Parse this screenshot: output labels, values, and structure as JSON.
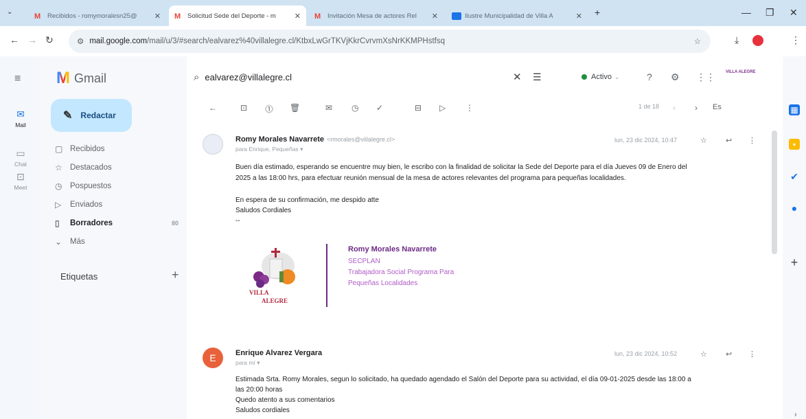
{
  "browser": {
    "tabs": [
      {
        "label": "Recibidos - romymoralesn25@",
        "active": false
      },
      {
        "label": "Solicitud Sede del Deporte - m",
        "active": true
      },
      {
        "label": "Invitación Mesa de actores Rel",
        "active": false
      },
      {
        "label": "Ilustre Municipalidad de Villa A",
        "active": false
      }
    ],
    "new_tab": "+",
    "url_host": "mail.google.com",
    "url_path": "/mail/u/3/#search/ealvarez%40villalegre.cl/KtbxLwGrTKVjKkrCvrvmXsNrKKMPHstfsq"
  },
  "rail": {
    "items": [
      {
        "label": "Mail",
        "icon": "mail-icon"
      },
      {
        "label": "Chat",
        "icon": "chat-icon"
      },
      {
        "label": "Meet",
        "icon": "video-icon"
      }
    ]
  },
  "gmail": {
    "logo_text": "Gmail",
    "search_value": "ealvarez@villalegre.cl",
    "status_label": "Activo",
    "brand_text": "VILLA ALEGRE"
  },
  "sidebar": {
    "compose": "Redactar",
    "items": [
      {
        "label": "Recibidos",
        "icon": "inbox-icon",
        "count": ""
      },
      {
        "label": "Destacados",
        "icon": "star-icon",
        "count": ""
      },
      {
        "label": "Pospuestos",
        "icon": "clock-icon",
        "count": ""
      },
      {
        "label": "Enviados",
        "icon": "send-icon",
        "count": ""
      },
      {
        "label": "Borradores",
        "icon": "draft-icon",
        "count": "80"
      },
      {
        "label": "Más",
        "icon": "chevron-down-icon",
        "count": ""
      }
    ],
    "labels_heading": "Etiquetas"
  },
  "toolbar": {
    "pager": "1 de 18",
    "lang": "Es"
  },
  "messages": [
    {
      "sender": "Romy Morales Navarrete",
      "email": "<rmorales@villalegre.cl>",
      "to": "para Enrique, Pequeñas",
      "date": "lun, 23 dic 2024, 10:47",
      "lines": [
        "Buen día estimado, esperando se encuentre muy bien, le escribo con la finalidad de solicitar la Sede del Deporte para el día Jueves 09 de Enero del",
        "2025 a las 18:00 hrs, para efectuar reunión mensual de la mesa de actores relevantes del programa para pequeñas localidades.",
        "",
        "En espera de su confirmación, me despido atte",
        "Saludos Cordiales",
        "--"
      ],
      "signature": {
        "name": "Romy Morales Navarrete",
        "dept": "SECPLAN",
        "role1": "Trabajadora Social Programa Para",
        "role2": "Pequeñas Localidades",
        "logo_text1": "VILLA",
        "logo_text2": "ALEGRE"
      }
    },
    {
      "sender": "Enrique Alvarez Vergara",
      "avatar_letter": "E",
      "to": "para mí",
      "date": "lun, 23 dic 2024, 10:52",
      "lines": [
        "Estimada Srta. Romy Morales, segun lo solicitado, ha quedado agendado el Salón del Deporte para su actividad, el día 09-01-2025 desde las 18:00 a",
        "las 20:00 horas",
        "Quedo atento a sus comentarios",
        "Saludos cordiales"
      ]
    }
  ],
  "colors": {
    "accent": "#1a73e8",
    "compose_bg": "#c2e7ff",
    "signature": "#6b2a84",
    "avatar_e": "#e8613a"
  }
}
